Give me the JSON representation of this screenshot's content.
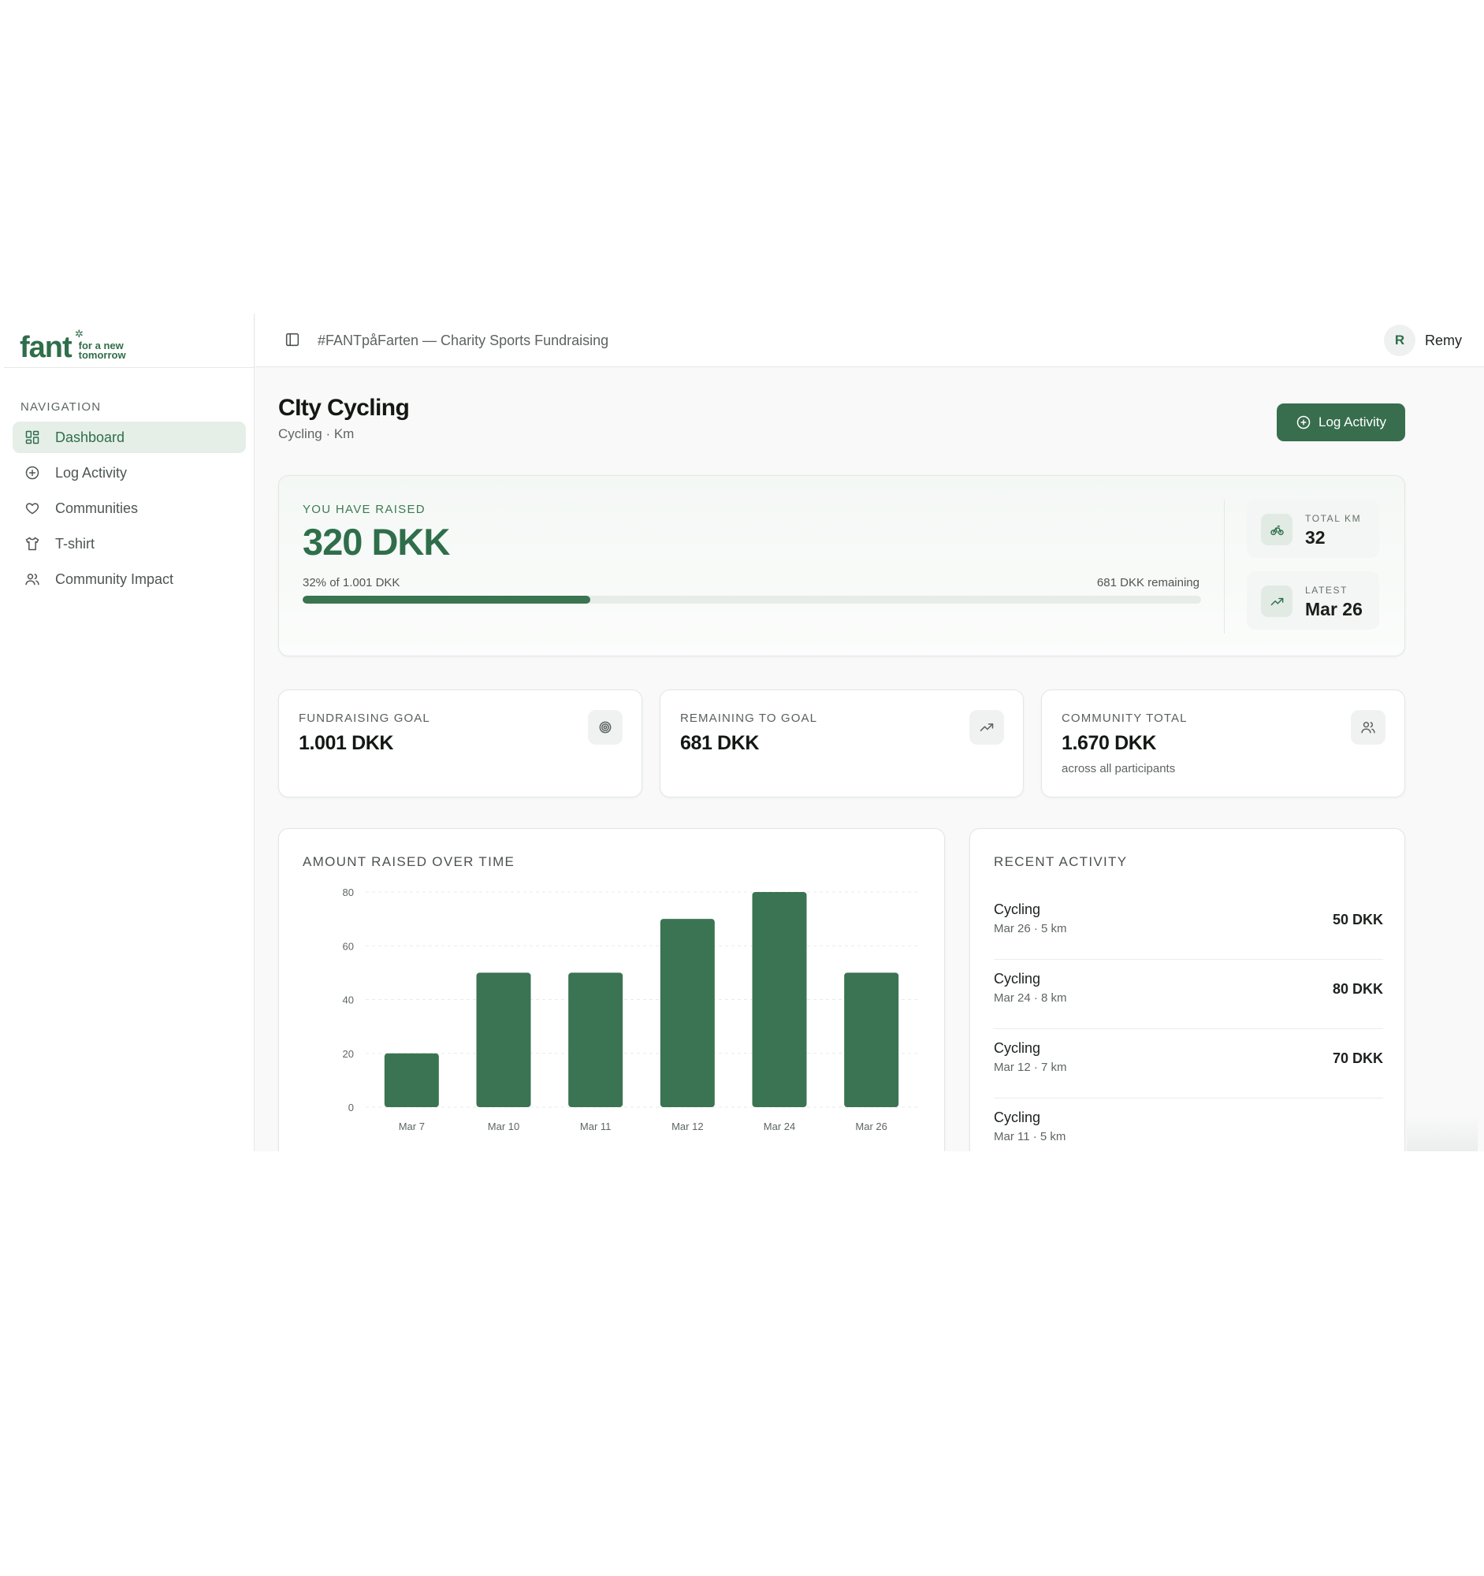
{
  "app": {
    "logo_word": "fant",
    "logo_tag_line1": "for a new",
    "logo_tag_line2": "tomorrow"
  },
  "sidebar": {
    "heading": "NAVIGATION",
    "items": [
      {
        "label": "Dashboard",
        "icon": "dashboard-icon",
        "active": true
      },
      {
        "label": "Log Activity",
        "icon": "plus-circle-icon",
        "active": false
      },
      {
        "label": "Communities",
        "icon": "heart-icon",
        "active": false
      },
      {
        "label": "T-shirt",
        "icon": "tshirt-icon",
        "active": false
      },
      {
        "label": "Community Impact",
        "icon": "users-icon",
        "active": false
      }
    ]
  },
  "header": {
    "title": "#FANTpåFarten — Charity Sports Fundraising",
    "user_initial": "R",
    "user_name": "Remy"
  },
  "page": {
    "title": "CIty Cycling",
    "subtitle": "Cycling · Km",
    "log_button": "Log Activity"
  },
  "hero": {
    "label": "YOU HAVE RAISED",
    "amount": "320 DKK",
    "progress_text": "32% of 1.001 DKK",
    "remaining_text": "681 DKK remaining",
    "progress_fraction": 0.32,
    "total_km_label": "TOTAL KM",
    "total_km_value": "32",
    "latest_label": "LATEST",
    "latest_value": "Mar 26"
  },
  "stats": [
    {
      "label": "FUNDRAISING GOAL",
      "value": "1.001 DKK",
      "sub": "",
      "icon": "target-icon"
    },
    {
      "label": "REMAINING TO GOAL",
      "value": "681 DKK",
      "sub": "",
      "icon": "trending-up-icon"
    },
    {
      "label": "COMMUNITY TOTAL",
      "value": "1.670 DKK",
      "sub": "across all participants",
      "icon": "users-icon"
    }
  ],
  "chart_title": "AMOUNT RAISED OVER TIME",
  "chart_data": {
    "type": "bar",
    "categories": [
      "Mar 7",
      "Mar 10",
      "Mar 11",
      "Mar 12",
      "Mar 24",
      "Mar 26"
    ],
    "values": [
      20,
      50,
      50,
      70,
      80,
      50
    ],
    "title": "AMOUNT RAISED OVER TIME",
    "xlabel": "",
    "ylabel": "",
    "ylim": [
      0,
      80
    ],
    "yticks": [
      0,
      20,
      40,
      60,
      80
    ],
    "grid": true,
    "bar_color": "#3a7452"
  },
  "activity": {
    "heading": "RECENT ACTIVITY",
    "items": [
      {
        "title": "Cycling",
        "meta": "Mar 26 · 5 km",
        "amount": "50 DKK"
      },
      {
        "title": "Cycling",
        "meta": "Mar 24 · 8 km",
        "amount": "80 DKK"
      },
      {
        "title": "Cycling",
        "meta": "Mar 12 · 7 km",
        "amount": "70 DKK"
      },
      {
        "title": "Cycling",
        "meta": "Mar 11 · 5 km",
        "amount": ""
      }
    ]
  },
  "colors": {
    "brand": "#2f6e4a",
    "button": "#386e4e",
    "active_nav_bg": "#e5efe8"
  }
}
